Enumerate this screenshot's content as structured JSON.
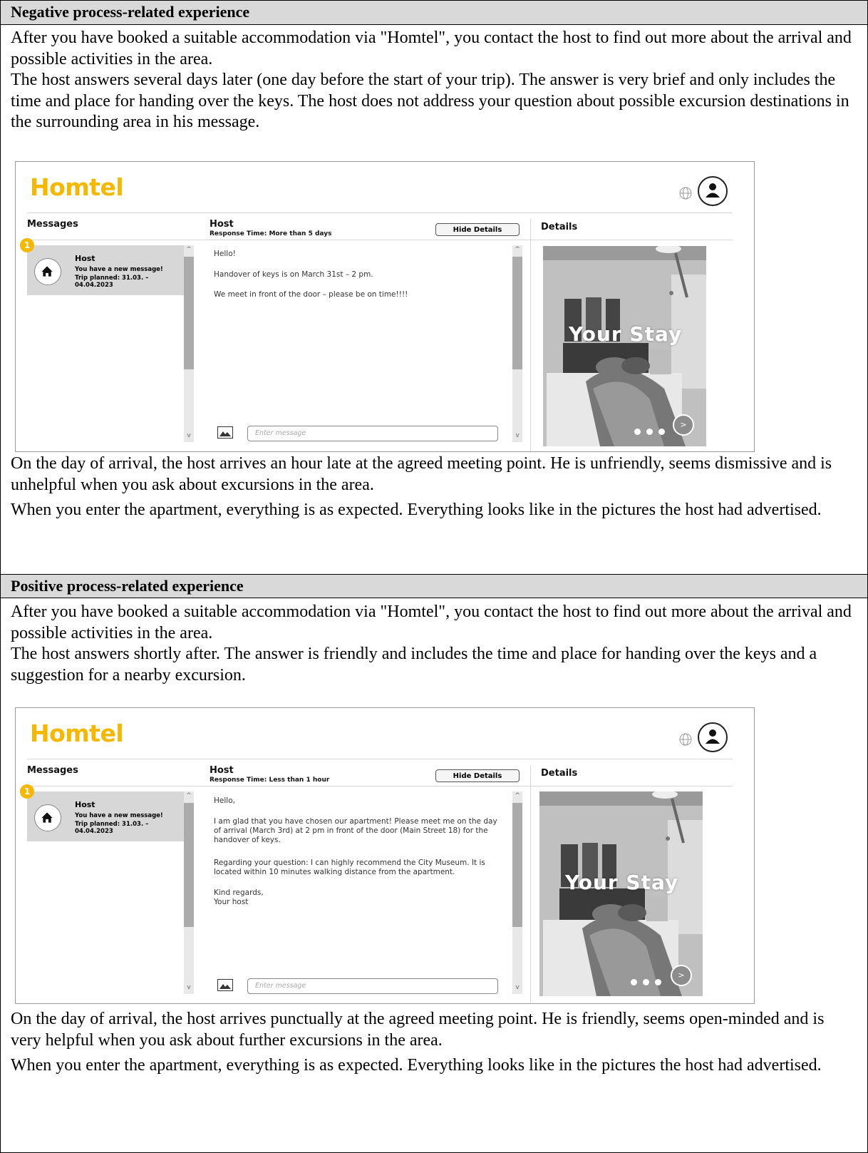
{
  "sections": [
    {
      "heading": "Negative process-related experience",
      "intro": "After you have booked a suitable accommodation via \"Homtel\", you contact the host to find out more about the arrival and possible activities in the area.",
      "reply_text": "The host answers several days later (one day before the start of your trip). The answer is very brief and only includes the time and place for handing over the keys. The host does not address your question about possible excursion destinations in the surrounding area in his message.",
      "after_1": "On the day of arrival, the host arrives an hour late at the agreed meeting point. He is unfriendly, seems dismissive and is unhelpful when you ask about excursions in the area.",
      "after_2": "When you enter the apartment, everything is as expected. Everything looks like in the pictures the host had advertised.",
      "mockup": {
        "response_time": "Response Time: More than 5 days",
        "messages": [
          "Hello!",
          "Handover of keys is on March 31st – 2 pm.",
          "We meet in front of the door – please be on time!!!!"
        ]
      }
    },
    {
      "heading": "Positive process-related experience",
      "intro": "After you have booked a suitable accommodation via \"Homtel\", you contact the host to find out more about the arrival and possible activities in the area.",
      "reply_text": "The host answers shortly after. The answer is friendly and includes the time and place for handing over the keys and a suggestion for a nearby excursion.",
      "after_1": "On the day of arrival, the host arrives punctually at the agreed meeting point. He is friendly, seems open-minded and is very helpful when you ask about further excursions in the area.",
      "after_2": "When you enter the apartment, everything is as expected. Everything looks like in the pictures the host had advertised.",
      "mockup": {
        "response_time": "Response Time: Less than 1 hour",
        "messages": [
          "Hello,",
          "I am glad that you have chosen our apartment! Please meet me on the day of arrival (March 3rd) at 2 pm in front of the door (Main Street 18) for the handover of keys.",
          "Regarding your question: I can highly recommend the City Museum. It is located within 10 minutes walking distance from the apartment.",
          "Kind regards,",
          "Your host"
        ]
      }
    }
  ],
  "app": {
    "logo": "Homtel",
    "messages_title": "Messages",
    "host_title": "Host",
    "details_title": "Details",
    "hide_details": "Hide Details",
    "badge": "1",
    "conversation": {
      "name": "Host",
      "line1": "You have a new message!",
      "line2": "Trip planned: 31.03. – 04.04.2023"
    },
    "input_placeholder": "Enter message",
    "photo_caption": "Your Stay",
    "next_label": ">",
    "brand_color": "#f5b800",
    "icons": [
      "globe-icon",
      "user-icon",
      "home-icon",
      "image-icon",
      "chevron-up-icon",
      "chevron-down-icon",
      "chevron-right-icon"
    ]
  }
}
